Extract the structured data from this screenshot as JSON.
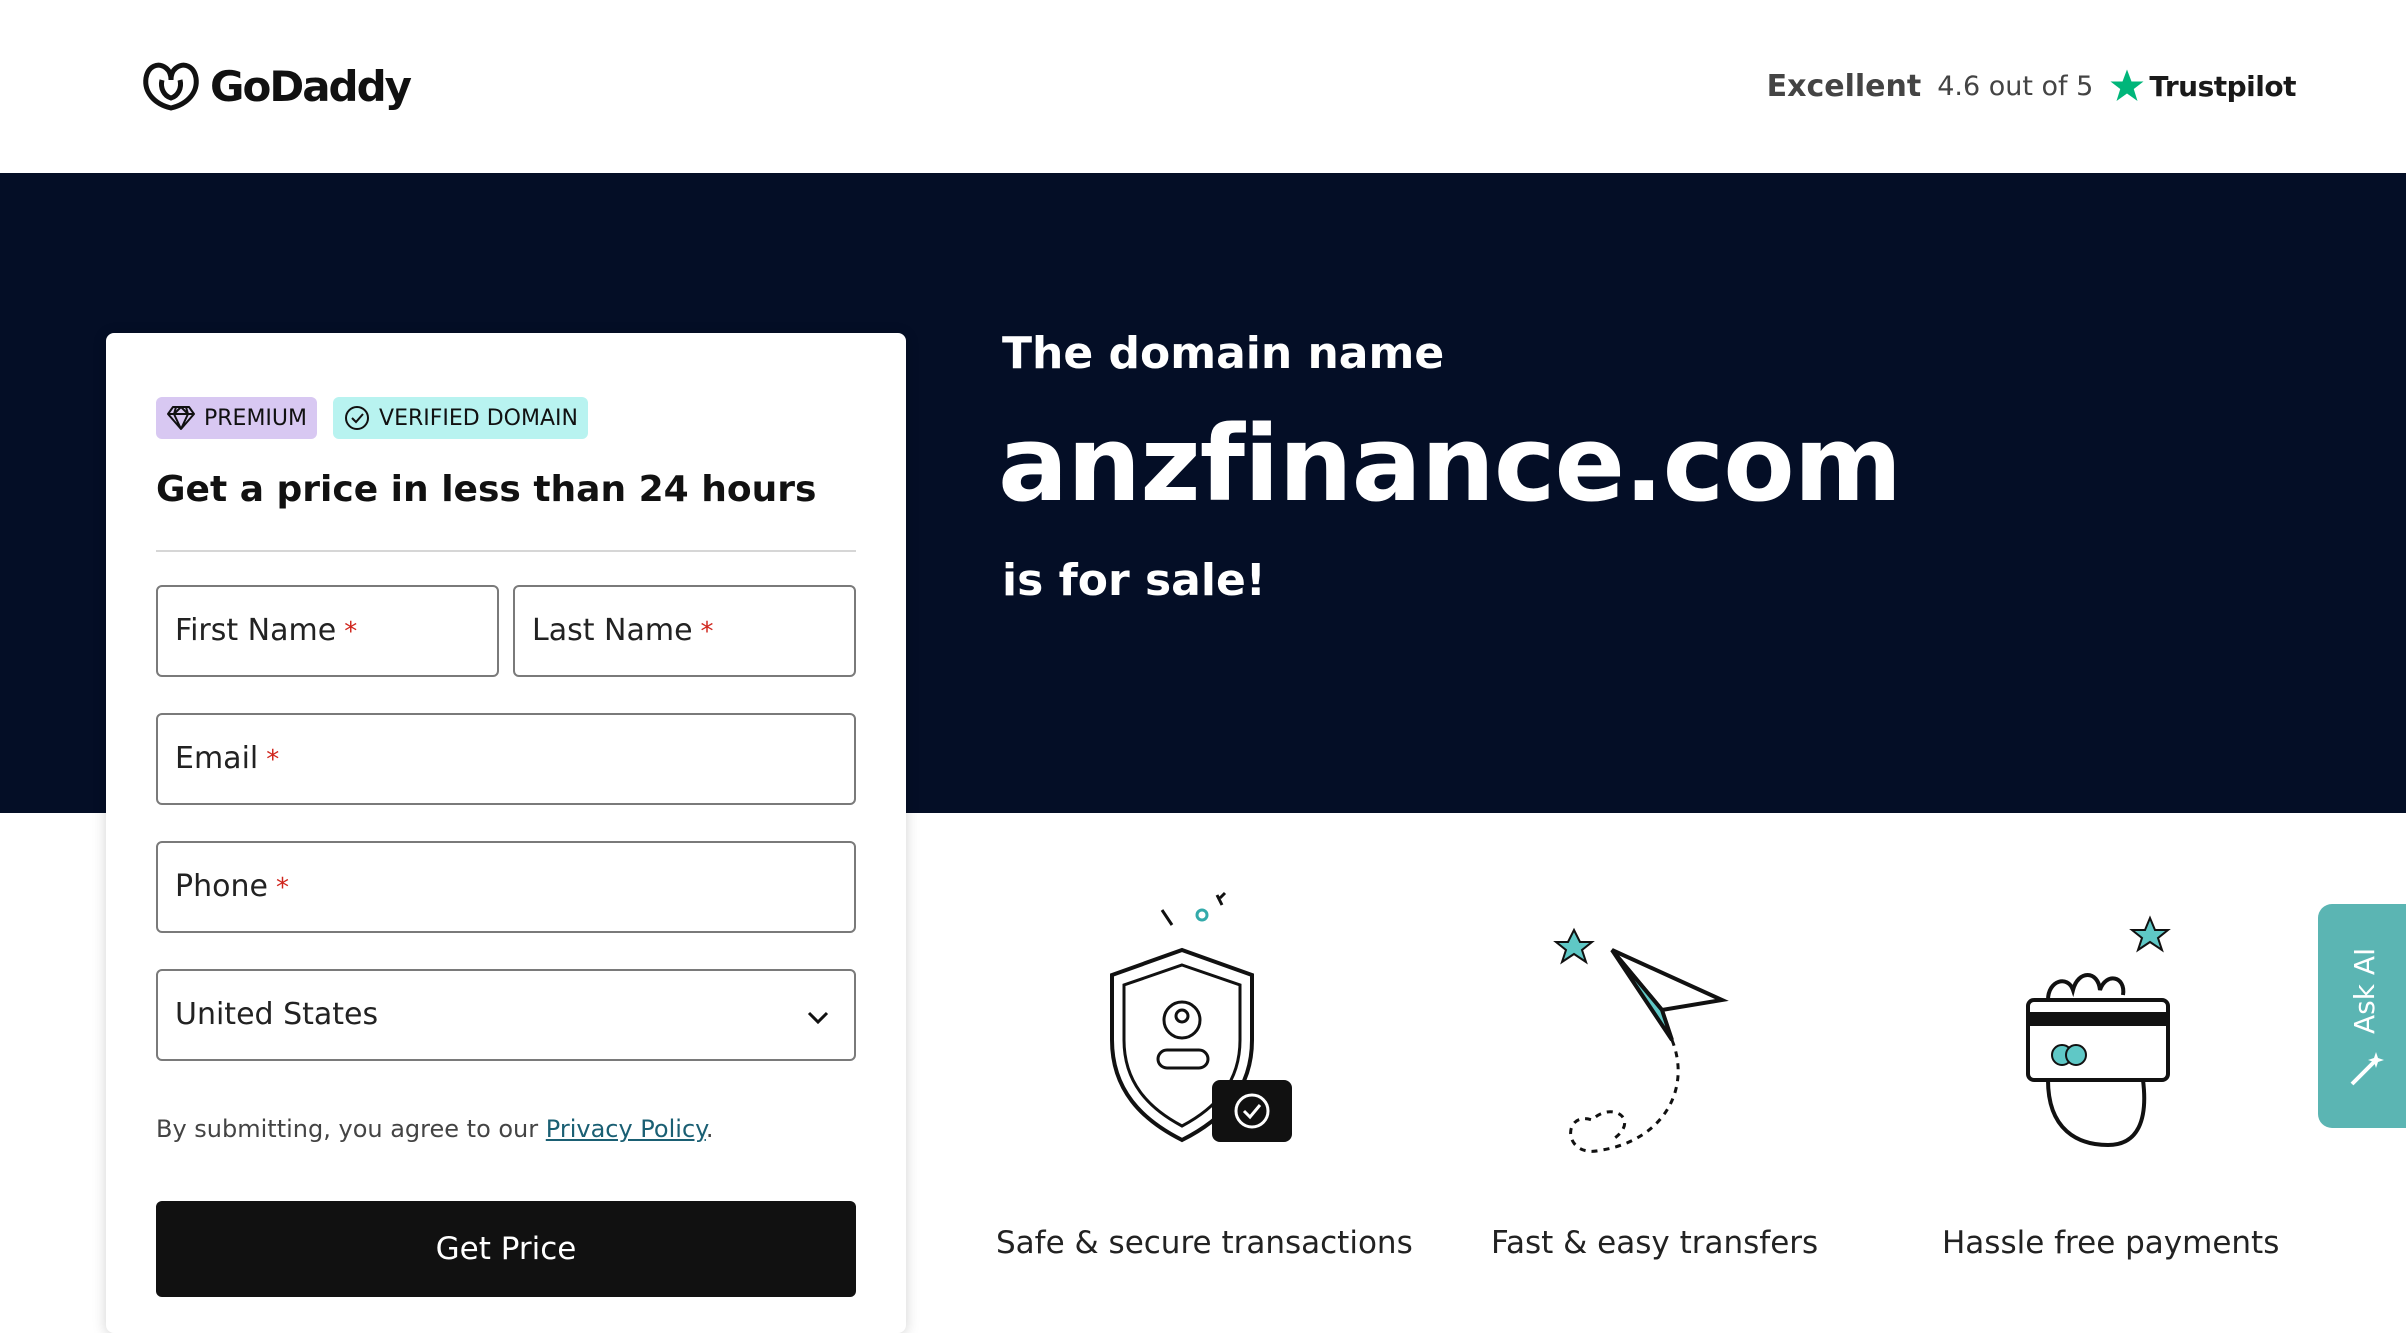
{
  "header": {
    "logo_text": "GoDaddy",
    "trust_rating": "Excellent",
    "trust_score": "4.6 out of 5",
    "trust_brand": "Trustpilot",
    "trust_star_color": "#00b67a"
  },
  "hero": {
    "line1": "The domain name",
    "domain": "anzfinance.com",
    "line2": "is for sale!",
    "background": "#040e26"
  },
  "form": {
    "badge_premium": "PREMIUM",
    "badge_verified": "VERIFIED DOMAIN",
    "title": "Get a price in less than 24 hours",
    "first_name_label": "First Name",
    "last_name_label": "Last Name",
    "email_label": "Email",
    "phone_label": "Phone",
    "required_mark": "*",
    "country_value": "United States",
    "consent_prefix": "By submitting, you agree to our",
    "consent_link": "Privacy Policy",
    "consent_suffix": ".",
    "submit_label": "Get Price"
  },
  "features": [
    {
      "label": "Safe & secure transactions",
      "icon": "shield-icon"
    },
    {
      "label": "Fast & easy transfers",
      "icon": "paper-plane-icon"
    },
    {
      "label": "Hassle free payments",
      "icon": "card-hand-icon"
    }
  ],
  "ask_ai": {
    "label": "Ask AI",
    "color": "#5bb5b3"
  }
}
